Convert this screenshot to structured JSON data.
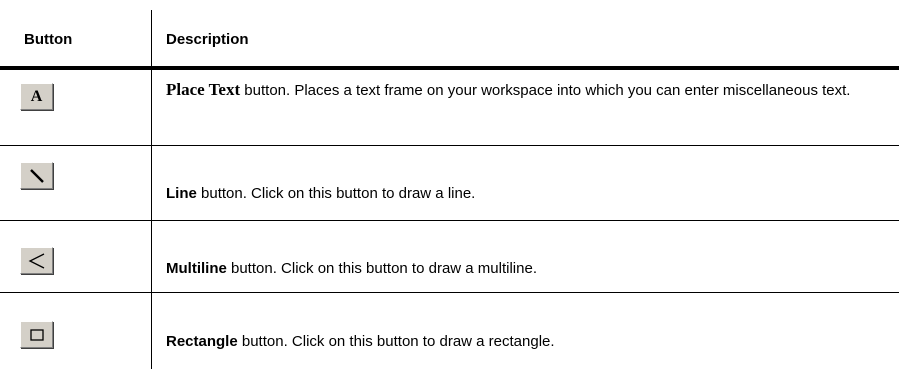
{
  "header": {
    "button_col": "Button",
    "description_col": "Description"
  },
  "rows": [
    {
      "icon": "place-text-icon",
      "icon_glyph": "A",
      "name": "Place Text",
      "text": " button. Places a text frame on your workspace into which you can enter miscellaneous text."
    },
    {
      "icon": "line-icon",
      "name": "Line",
      "text": " button. Click on this button to draw a line."
    },
    {
      "icon": "multiline-icon",
      "name": "Multiline",
      "text": " button. Click on this button to draw a multiline."
    },
    {
      "icon": "rectangle-icon",
      "name": "Rectangle",
      "text": " button. Click on this button to draw a rectangle."
    }
  ]
}
